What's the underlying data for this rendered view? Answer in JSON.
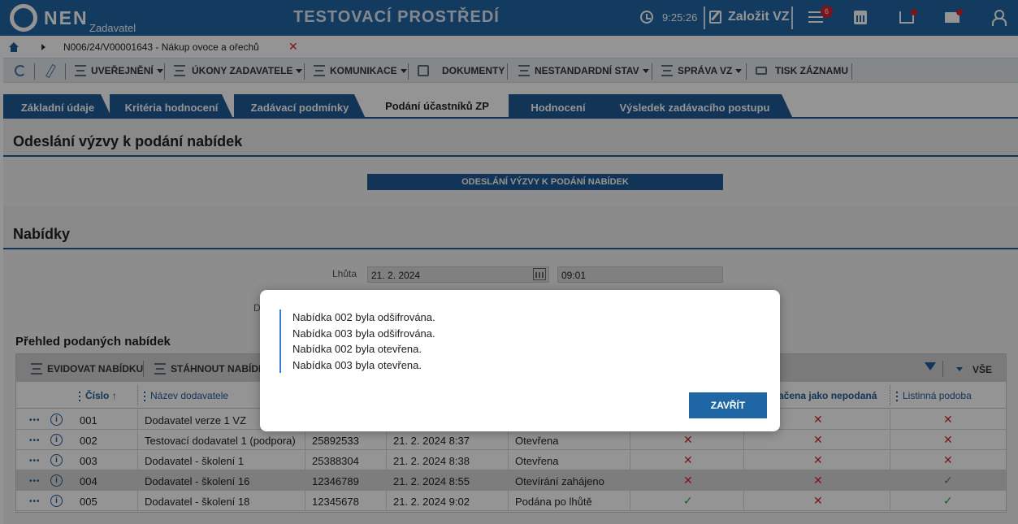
{
  "header": {
    "logo_text": "NEN",
    "logo_sub": "Zadavatel",
    "environment_title": "TESTOVACÍ PROSTŘEDÍ",
    "time": "9:25:26",
    "create_vz": "Založit VZ",
    "notification_count": "6"
  },
  "breadcrumb": {
    "text": "N006/24/V00001643 - Nákup ovoce a ořechů",
    "close": "✕"
  },
  "toolbar": {
    "items": [
      "UVEŘEJNĚNÍ",
      "ÚKONY ZADAVATELE",
      "KOMUNIKACE",
      "DOKUMENTY",
      "NESTANDARDNÍ STAV",
      "SPRÁVA VZ",
      "TISK ZÁZNAMU"
    ]
  },
  "tabs": [
    "Základní údaje",
    "Kritéria hodnocení",
    "Zadávací podmínky",
    "Podání účastníků ZP",
    "Hodnocení",
    "Výsledek zadávacího postupu"
  ],
  "section1": {
    "title": "Odeslání výzvy k podání nabídek",
    "button": "ODESLÁNÍ VÝZVY K PODÁNÍ NABÍDEK"
  },
  "section2": {
    "title": "Nabídky",
    "deadline_label": "Lhůta",
    "deadline_date": "21. 2. 2024",
    "deadline_time": "09:01",
    "partial_label": "D"
  },
  "table": {
    "title": "Přehled podaných nabídek",
    "toolbar": {
      "record": "EVIDOVAT NABÍDKU",
      "download": "STÁHNOUT NABÍDK",
      "all": "VŠE"
    },
    "headers": {
      "number": "Číslo",
      "supplier": "Název dodavatele",
      "rejected": "ačena jako nepodaná",
      "paper": "Listinná podoba"
    },
    "rows": [
      {
        "number": "001",
        "supplier": "Dodavatel verze 1 VZ",
        "ico": "",
        "date": "",
        "state": "",
        "c1": "",
        "c2": "cross",
        "c3": "cross"
      },
      {
        "number": "002",
        "supplier": "Testovací dodavatel 1 (podpora)",
        "ico": "25892533",
        "date": "21. 2. 2024 8:37",
        "state": "Otevřena",
        "c1": "cross",
        "c2": "cross",
        "c3": "cross"
      },
      {
        "number": "003",
        "supplier": "Dodavatel - školení 1",
        "ico": "25388304",
        "date": "21. 2. 2024 8:38",
        "state": "Otevřena",
        "c1": "cross",
        "c2": "cross",
        "c3": "cross"
      },
      {
        "number": "004",
        "supplier": "Dodavatel - školení 16",
        "ico": "12346789",
        "date": "21. 2. 2024 8:55",
        "state": "Otevírání zahájeno",
        "c1": "cross",
        "c2": "cross",
        "c3": "check"
      },
      {
        "number": "005",
        "supplier": "Dodavatel - školení 18",
        "ico": "12345678",
        "date": "21. 2. 2024 9:02",
        "state": "Podána po lhůtě",
        "c1": "check",
        "c2": "cross",
        "c3": "check"
      }
    ]
  },
  "modal": {
    "messages": [
      "Nabídka 002 byla odšifrována.",
      "Nabídka 003 byla odšifrována.",
      "Nabídka 002 byla otevřena.",
      "Nabídka 003 byla otevřena."
    ],
    "close_label": "ZAVŘÍT"
  },
  "colors": {
    "brand": "#1f67a4",
    "accent": "#1f5a95",
    "error": "#d9232e",
    "success": "#3a9a3a"
  }
}
